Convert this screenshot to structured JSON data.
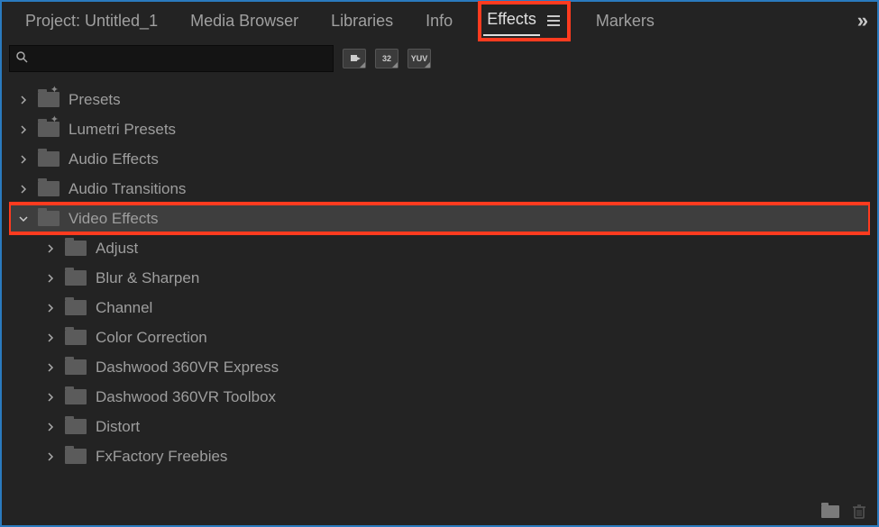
{
  "tabs": {
    "project": "Project: Untitled_1",
    "media_browser": "Media Browser",
    "libraries": "Libraries",
    "info": "Info",
    "effects": "Effects",
    "markers": "Markers"
  },
  "filters": {
    "btn1": "▶",
    "btn2": "32",
    "btn3": "YUV"
  },
  "search": {
    "placeholder": ""
  },
  "tree": {
    "presets": "Presets",
    "lumetri": "Lumetri Presets",
    "audio_effects": "Audio Effects",
    "audio_transitions": "Audio Transitions",
    "video_effects": "Video Effects",
    "children": {
      "adjust": "Adjust",
      "blur": "Blur & Sharpen",
      "channel": "Channel",
      "color": "Color Correction",
      "dw_express": "Dashwood 360VR Express",
      "dw_toolbox": "Dashwood 360VR Toolbox",
      "distort": "Distort",
      "fx": "FxFactory Freebies"
    }
  }
}
